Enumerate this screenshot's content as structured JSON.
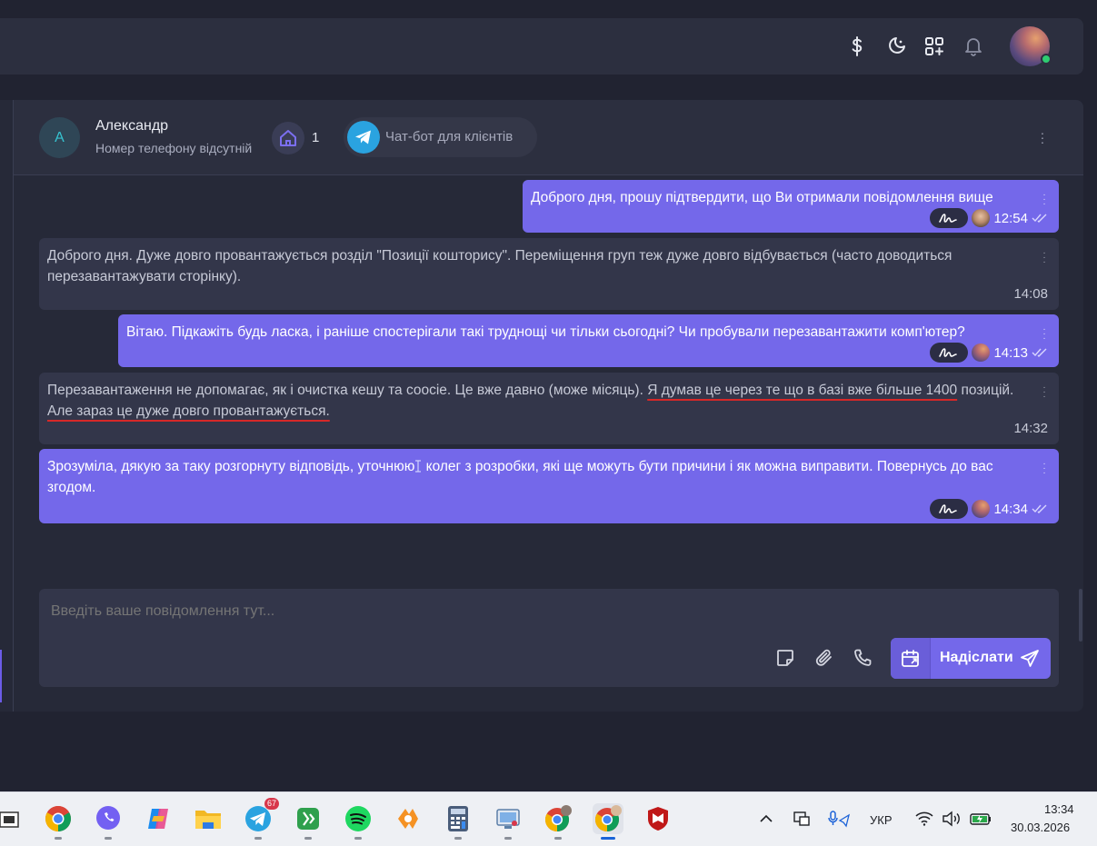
{
  "topbar": {
    "icons": [
      "dollar-icon",
      "moon-icon",
      "apps-add-icon",
      "bell-icon"
    ],
    "user_avatar": "user-avatar",
    "status_color": "#2ecc71"
  },
  "chat": {
    "contact": {
      "initial": "A",
      "name": "Александр",
      "subtitle": "Номер телефону відсутній",
      "properties_count": "1",
      "channel_label": "Чат-бот для клієнтів"
    },
    "messages": [
      {
        "direction": "out",
        "text": "Доброго дня, прошу підтвердити, що Ви отримали повідомлення вище",
        "time": "12:54"
      },
      {
        "direction": "in",
        "text": "Доброго дня. Дуже довго провантажується розділ \"Позиції кошторису\". Переміщення груп теж дуже довго відбувається (часто доводиться перезавантажувати сторінку).",
        "time": "14:08"
      },
      {
        "direction": "out",
        "text": "Вітаю. Підкажіть будь ласка, і раніше спостерігали такі труднощі чи тільки сьогодні? Чи пробували перезавантажити комп'ютер?",
        "time": "14:13"
      },
      {
        "direction": "in",
        "parts": [
          "Перезавантаження не допомагає, як і очистка кешу та соосіе. Це вже давно (може місяць). ",
          "Я думав це через те що в базі вже більше 1400",
          " позицій. ",
          "Але зараз це дуже довго провантажується."
        ],
        "time": "14:32"
      },
      {
        "direction": "out",
        "parts": [
          "Зрозуміла, дякую за таку розгорнуту відповідь, уточнюю",
          " колег з розробки, які ще можуть бути причини і як можна виправити. Повернусь до вас згодом."
        ],
        "time": "14:34"
      }
    ],
    "composer": {
      "placeholder": "Введіть ваше повідомлення тут...",
      "send_label": "Надіслати"
    }
  },
  "taskbar": {
    "apps": [
      "file-explorer",
      "chrome",
      "viber",
      "copilot",
      "folder",
      "telegram",
      "phone-link",
      "spotify",
      "blender",
      "calculator",
      "remote-desktop",
      "chrome-profile-1",
      "chrome-profile-2",
      "mcafee"
    ],
    "telegram_badge": "67",
    "language": "УКР",
    "time": "13:34",
    "date": "30.03.2026"
  }
}
